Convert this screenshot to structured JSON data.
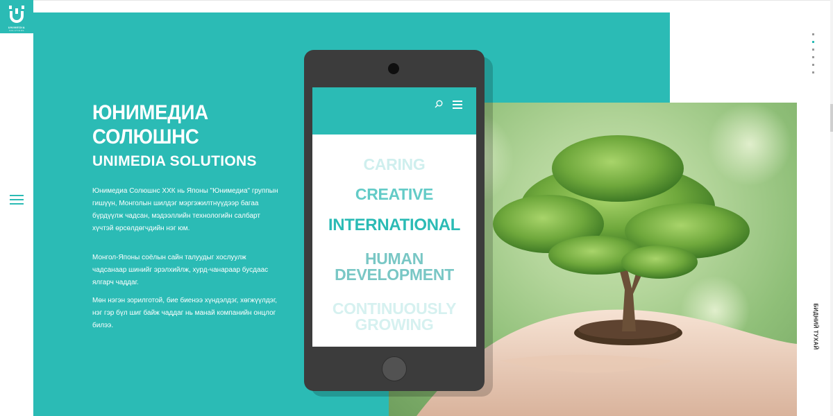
{
  "logo": {
    "name": "UNIMEDIA",
    "sub": "SOLUTIONS"
  },
  "hero": {
    "title_mn_line1": "ЮНИМЕДИА",
    "title_mn_line2": "СОЛЮШНС",
    "title_en": "UNIMEDIA SOLUTIONS",
    "paragraphs": [
      "Юнимедиа Солюшнс ХХК нь Японы \"Юнимедиа\" группын гишүүн, Монголын шилдэг мэргэжилтнүүдээр багаа бүрдүүлж чадсан, мэдээллийн технологийн салбарт хүчтэй өрсөлдөгчдийн нэг юм.",
      "Монгол-Японы соёлын сайн талуудыг хослуулж чадсанаар шинийг эрэлхийлж, хурд-чанараар бусдаас ялгарч чаддаг.",
      "Мөн нэгэн зорилготой, бие биенээ хүндэлдэг, хөгжүүлдэг, нэг гэр бүл шиг байж чаддаг нь манай компанийн онцлог билээ."
    ]
  },
  "phone": {
    "words": [
      {
        "line1": "CARING",
        "line2": ""
      },
      {
        "line1": "CREATIVE",
        "line2": ""
      },
      {
        "line1": "INTERNATIONAL",
        "line2": ""
      },
      {
        "line1": "HUMAN",
        "line2": "DEVELOPMENT"
      },
      {
        "line1": "CONTINUOUSLY",
        "line2": "GROWING"
      }
    ]
  },
  "side_label": "БИДНИЙ ТУХАЙ",
  "pager": {
    "count": 6,
    "active_index": 1
  },
  "colors": {
    "accent": "#2bbbb5",
    "white": "#ffffff",
    "phone_body": "#3c3c3c"
  },
  "icons": {
    "menu": "hamburger-icon",
    "search": "search-icon",
    "logo": "u-logo-icon"
  }
}
